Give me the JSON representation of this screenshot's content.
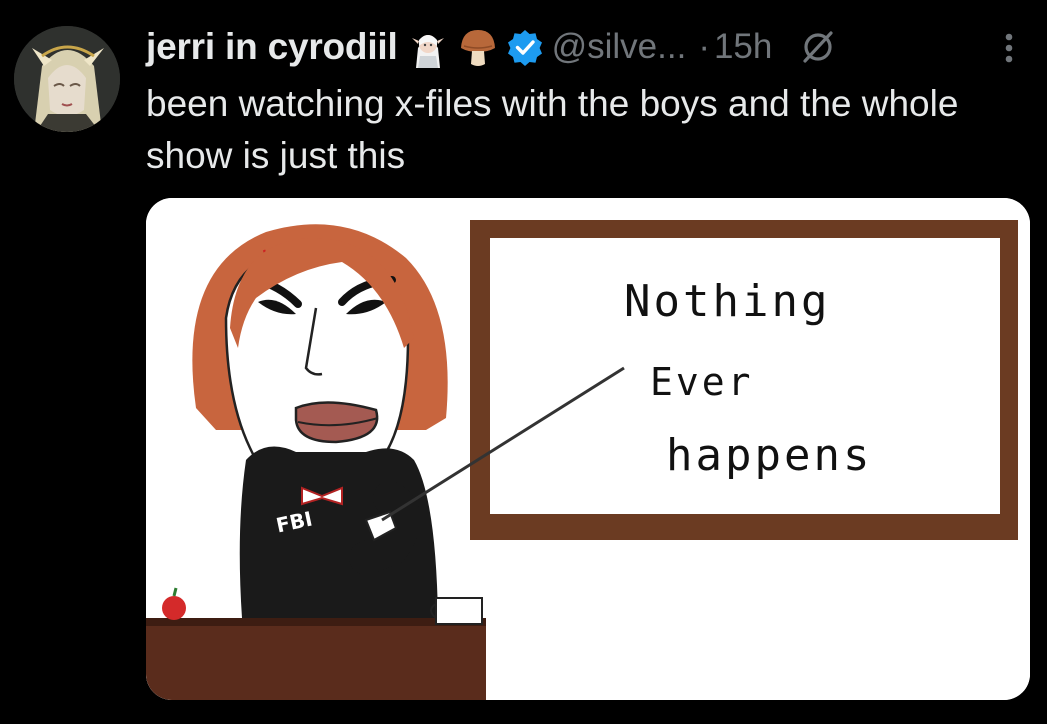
{
  "tweet": {
    "display_name": "jerri in cyrodiil",
    "handle": "@silve...",
    "separator": "·",
    "time": "15h",
    "text": "been watching x-files with the boys and the whole show is just this",
    "badges": [
      "elf-emoji",
      "mushroom-emoji",
      "verified-badge-icon"
    ],
    "header_icons": [
      "no-entry-icon",
      "more-options-icon"
    ]
  },
  "media": {
    "board_lines": [
      "Nothing",
      "Ever",
      "happens"
    ],
    "shirt_text": "FBI"
  },
  "colors": {
    "background": "#000000",
    "primary_text": "#e7e9ea",
    "secondary_text": "#71767b",
    "verified_blue": "#1d9bf0",
    "hair": "#c8653e",
    "board_frame": "#6b3b22",
    "desk": "#5a2c1c"
  }
}
